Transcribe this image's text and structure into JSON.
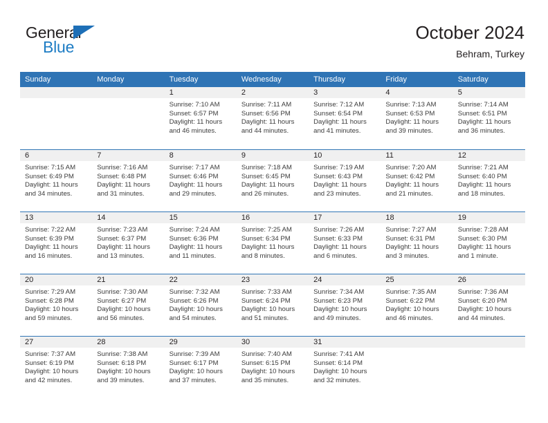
{
  "brand": {
    "word_general": "General",
    "word_blue": "Blue",
    "flag_icon": "triangle-flag-icon"
  },
  "header": {
    "title": "October 2024",
    "subtitle": "Behram, Turkey"
  },
  "colors": {
    "header_blue": "#2f74b5",
    "band_gray": "#f0f0f0",
    "brand_blue": "#1d7cc4",
    "text": "#231f20"
  },
  "weekday_headers": [
    "Sunday",
    "Monday",
    "Tuesday",
    "Wednesday",
    "Thursday",
    "Friday",
    "Saturday"
  ],
  "labels": {
    "sunrise_prefix": "Sunrise:",
    "sunset_prefix": "Sunset:",
    "daylight_prefix": "Daylight:"
  },
  "weeks": [
    [
      {
        "day": "",
        "line1": "",
        "line2": "",
        "line3": "",
        "line4": ""
      },
      {
        "day": "",
        "line1": "",
        "line2": "",
        "line3": "",
        "line4": ""
      },
      {
        "day": "1",
        "line1": "Sunrise: 7:10 AM",
        "line2": "Sunset: 6:57 PM",
        "line3": "Daylight: 11 hours",
        "line4": "and 46 minutes."
      },
      {
        "day": "2",
        "line1": "Sunrise: 7:11 AM",
        "line2": "Sunset: 6:56 PM",
        "line3": "Daylight: 11 hours",
        "line4": "and 44 minutes."
      },
      {
        "day": "3",
        "line1": "Sunrise: 7:12 AM",
        "line2": "Sunset: 6:54 PM",
        "line3": "Daylight: 11 hours",
        "line4": "and 41 minutes."
      },
      {
        "day": "4",
        "line1": "Sunrise: 7:13 AM",
        "line2": "Sunset: 6:53 PM",
        "line3": "Daylight: 11 hours",
        "line4": "and 39 minutes."
      },
      {
        "day": "5",
        "line1": "Sunrise: 7:14 AM",
        "line2": "Sunset: 6:51 PM",
        "line3": "Daylight: 11 hours",
        "line4": "and 36 minutes."
      }
    ],
    [
      {
        "day": "6",
        "line1": "Sunrise: 7:15 AM",
        "line2": "Sunset: 6:49 PM",
        "line3": "Daylight: 11 hours",
        "line4": "and 34 minutes."
      },
      {
        "day": "7",
        "line1": "Sunrise: 7:16 AM",
        "line2": "Sunset: 6:48 PM",
        "line3": "Daylight: 11 hours",
        "line4": "and 31 minutes."
      },
      {
        "day": "8",
        "line1": "Sunrise: 7:17 AM",
        "line2": "Sunset: 6:46 PM",
        "line3": "Daylight: 11 hours",
        "line4": "and 29 minutes."
      },
      {
        "day": "9",
        "line1": "Sunrise: 7:18 AM",
        "line2": "Sunset: 6:45 PM",
        "line3": "Daylight: 11 hours",
        "line4": "and 26 minutes."
      },
      {
        "day": "10",
        "line1": "Sunrise: 7:19 AM",
        "line2": "Sunset: 6:43 PM",
        "line3": "Daylight: 11 hours",
        "line4": "and 23 minutes."
      },
      {
        "day": "11",
        "line1": "Sunrise: 7:20 AM",
        "line2": "Sunset: 6:42 PM",
        "line3": "Daylight: 11 hours",
        "line4": "and 21 minutes."
      },
      {
        "day": "12",
        "line1": "Sunrise: 7:21 AM",
        "line2": "Sunset: 6:40 PM",
        "line3": "Daylight: 11 hours",
        "line4": "and 18 minutes."
      }
    ],
    [
      {
        "day": "13",
        "line1": "Sunrise: 7:22 AM",
        "line2": "Sunset: 6:39 PM",
        "line3": "Daylight: 11 hours",
        "line4": "and 16 minutes."
      },
      {
        "day": "14",
        "line1": "Sunrise: 7:23 AM",
        "line2": "Sunset: 6:37 PM",
        "line3": "Daylight: 11 hours",
        "line4": "and 13 minutes."
      },
      {
        "day": "15",
        "line1": "Sunrise: 7:24 AM",
        "line2": "Sunset: 6:36 PM",
        "line3": "Daylight: 11 hours",
        "line4": "and 11 minutes."
      },
      {
        "day": "16",
        "line1": "Sunrise: 7:25 AM",
        "line2": "Sunset: 6:34 PM",
        "line3": "Daylight: 11 hours",
        "line4": "and 8 minutes."
      },
      {
        "day": "17",
        "line1": "Sunrise: 7:26 AM",
        "line2": "Sunset: 6:33 PM",
        "line3": "Daylight: 11 hours",
        "line4": "and 6 minutes."
      },
      {
        "day": "18",
        "line1": "Sunrise: 7:27 AM",
        "line2": "Sunset: 6:31 PM",
        "line3": "Daylight: 11 hours",
        "line4": "and 3 minutes."
      },
      {
        "day": "19",
        "line1": "Sunrise: 7:28 AM",
        "line2": "Sunset: 6:30 PM",
        "line3": "Daylight: 11 hours",
        "line4": "and 1 minute."
      }
    ],
    [
      {
        "day": "20",
        "line1": "Sunrise: 7:29 AM",
        "line2": "Sunset: 6:28 PM",
        "line3": "Daylight: 10 hours",
        "line4": "and 59 minutes."
      },
      {
        "day": "21",
        "line1": "Sunrise: 7:30 AM",
        "line2": "Sunset: 6:27 PM",
        "line3": "Daylight: 10 hours",
        "line4": "and 56 minutes."
      },
      {
        "day": "22",
        "line1": "Sunrise: 7:32 AM",
        "line2": "Sunset: 6:26 PM",
        "line3": "Daylight: 10 hours",
        "line4": "and 54 minutes."
      },
      {
        "day": "23",
        "line1": "Sunrise: 7:33 AM",
        "line2": "Sunset: 6:24 PM",
        "line3": "Daylight: 10 hours",
        "line4": "and 51 minutes."
      },
      {
        "day": "24",
        "line1": "Sunrise: 7:34 AM",
        "line2": "Sunset: 6:23 PM",
        "line3": "Daylight: 10 hours",
        "line4": "and 49 minutes."
      },
      {
        "day": "25",
        "line1": "Sunrise: 7:35 AM",
        "line2": "Sunset: 6:22 PM",
        "line3": "Daylight: 10 hours",
        "line4": "and 46 minutes."
      },
      {
        "day": "26",
        "line1": "Sunrise: 7:36 AM",
        "line2": "Sunset: 6:20 PM",
        "line3": "Daylight: 10 hours",
        "line4": "and 44 minutes."
      }
    ],
    [
      {
        "day": "27",
        "line1": "Sunrise: 7:37 AM",
        "line2": "Sunset: 6:19 PM",
        "line3": "Daylight: 10 hours",
        "line4": "and 42 minutes."
      },
      {
        "day": "28",
        "line1": "Sunrise: 7:38 AM",
        "line2": "Sunset: 6:18 PM",
        "line3": "Daylight: 10 hours",
        "line4": "and 39 minutes."
      },
      {
        "day": "29",
        "line1": "Sunrise: 7:39 AM",
        "line2": "Sunset: 6:17 PM",
        "line3": "Daylight: 10 hours",
        "line4": "and 37 minutes."
      },
      {
        "day": "30",
        "line1": "Sunrise: 7:40 AM",
        "line2": "Sunset: 6:15 PM",
        "line3": "Daylight: 10 hours",
        "line4": "and 35 minutes."
      },
      {
        "day": "31",
        "line1": "Sunrise: 7:41 AM",
        "line2": "Sunset: 6:14 PM",
        "line3": "Daylight: 10 hours",
        "line4": "and 32 minutes."
      },
      {
        "day": "",
        "line1": "",
        "line2": "",
        "line3": "",
        "line4": ""
      },
      {
        "day": "",
        "line1": "",
        "line2": "",
        "line3": "",
        "line4": ""
      }
    ]
  ]
}
